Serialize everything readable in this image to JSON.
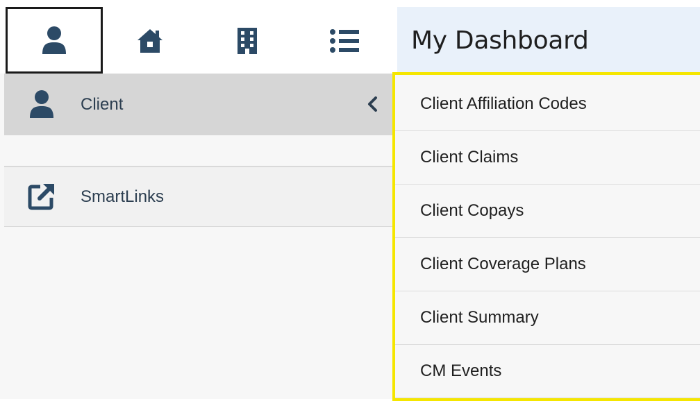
{
  "header": {
    "title": "My Dashboard",
    "icons": [
      {
        "name": "user-icon",
        "active": true
      },
      {
        "name": "home-icon",
        "active": false
      },
      {
        "name": "building-icon",
        "active": false
      },
      {
        "name": "list-icon",
        "active": false
      }
    ]
  },
  "sidebar": {
    "items": [
      {
        "label": "Client",
        "icon": "user-icon",
        "expanded": true
      },
      {
        "label": "SmartLinks",
        "icon": "external-link-icon"
      }
    ]
  },
  "submenu": {
    "items": [
      {
        "label": "Client Affiliation Codes"
      },
      {
        "label": "Client Claims"
      },
      {
        "label": "Client Copays"
      },
      {
        "label": "Client Coverage Plans"
      },
      {
        "label": "Client Summary"
      },
      {
        "label": "CM Events"
      }
    ]
  },
  "colors": {
    "icon": "#2c4a66",
    "highlight_border": "#f5e600",
    "title_bg": "#e9f1fa",
    "active_item_bg": "#d6d6d6"
  }
}
